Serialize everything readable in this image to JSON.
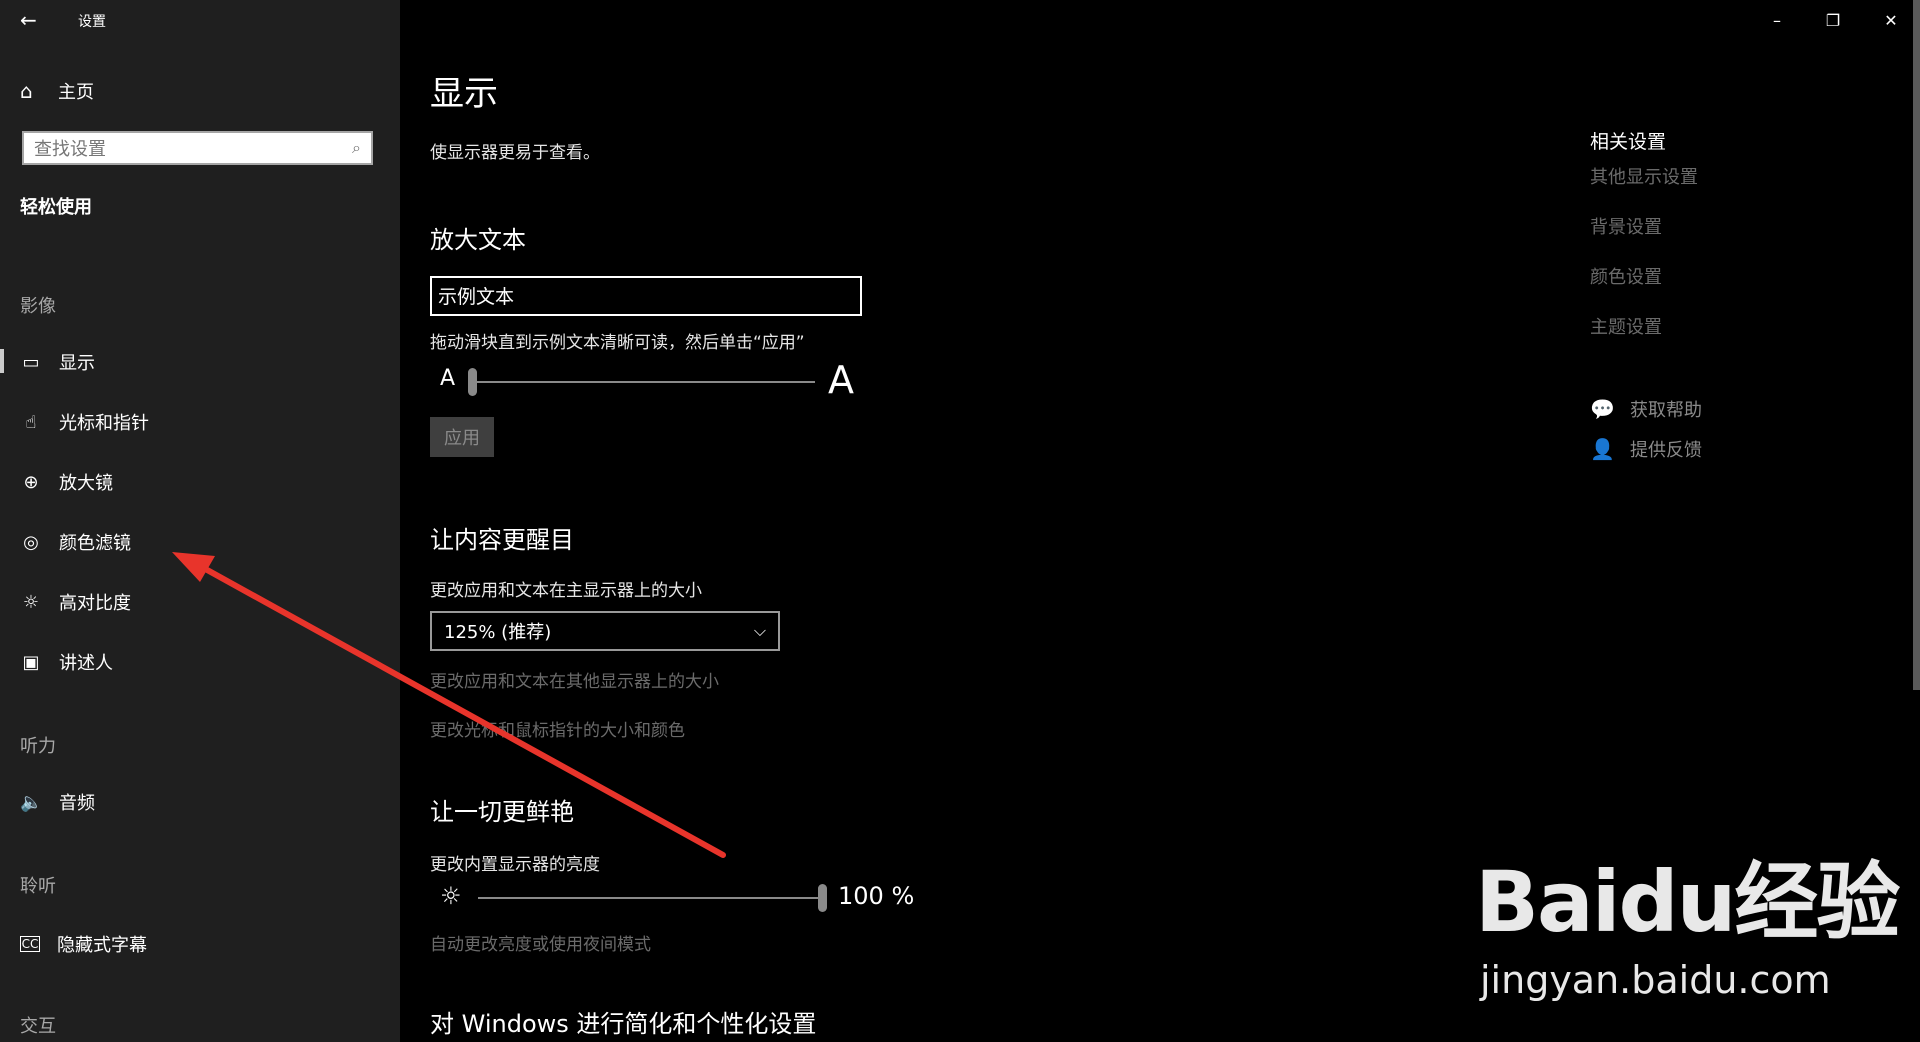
{
  "window": {
    "title": "设置",
    "back_icon": "back-arrow-icon",
    "minimize": "–",
    "maximize": "❐",
    "close": "✕"
  },
  "sidebar": {
    "home_label": "主页",
    "search_placeholder": "查找设置",
    "section_title": "轻松使用",
    "groups": {
      "vision": "影像",
      "hearing": "听力",
      "hearing2": "聆听",
      "interaction": "交互"
    },
    "items": [
      {
        "label": "显示",
        "icon": "monitor-icon",
        "active": true
      },
      {
        "label": "光标和指针",
        "icon": "pointer-icon"
      },
      {
        "label": "放大镜",
        "icon": "magnifier-icon"
      },
      {
        "label": "颜色滤镜",
        "icon": "palette-icon"
      },
      {
        "label": "高对比度",
        "icon": "sun-icon"
      },
      {
        "label": "讲述人",
        "icon": "narrator-icon"
      },
      {
        "label": "音频",
        "icon": "speaker-icon"
      },
      {
        "label": "隐藏式字幕",
        "icon": "closed-caption-icon"
      }
    ]
  },
  "main": {
    "title": "显示",
    "subtitle": "使显示器更易于查看。",
    "enlarge_text": {
      "heading": "放大文本",
      "sample": "示例文本",
      "instruction": "拖动滑块直到示例文本清晰可读，然后单击“应用”",
      "small_a": "A",
      "big_a": "A",
      "slider_value": 0,
      "apply": "应用"
    },
    "content": {
      "heading": "让内容更醒目",
      "scale_label": "更改应用和文本在主显示器上的大小",
      "scale_value": "125% (推荐)",
      "other_displays_link": "更改应用和文本在其他显示器上的大小",
      "cursor_link": "更改光标和鼠标指针的大小和颜色"
    },
    "brightness": {
      "heading": "让一切更鲜艳",
      "label": "更改内置显示器的亮度",
      "value": "100 %",
      "level": 1.0,
      "auto_link": "自动更改亮度或使用夜间模式"
    },
    "personalize": {
      "heading": "对 Windows 进行简化和个性化设置"
    }
  },
  "related": {
    "title": "相关设置",
    "links": [
      "其他显示设置",
      "背景设置",
      "颜色设置",
      "主题设置"
    ],
    "help": "获取帮助",
    "feedback": "提供反馈"
  },
  "watermark": {
    "logo": "Baidu经验",
    "url": "jingyan.baidu.com"
  },
  "colors": {
    "sidebar_bg": "#1f1f1f",
    "main_bg": "#000000",
    "dim_text": "#6b6b6b",
    "arrow": "#e8342b"
  }
}
